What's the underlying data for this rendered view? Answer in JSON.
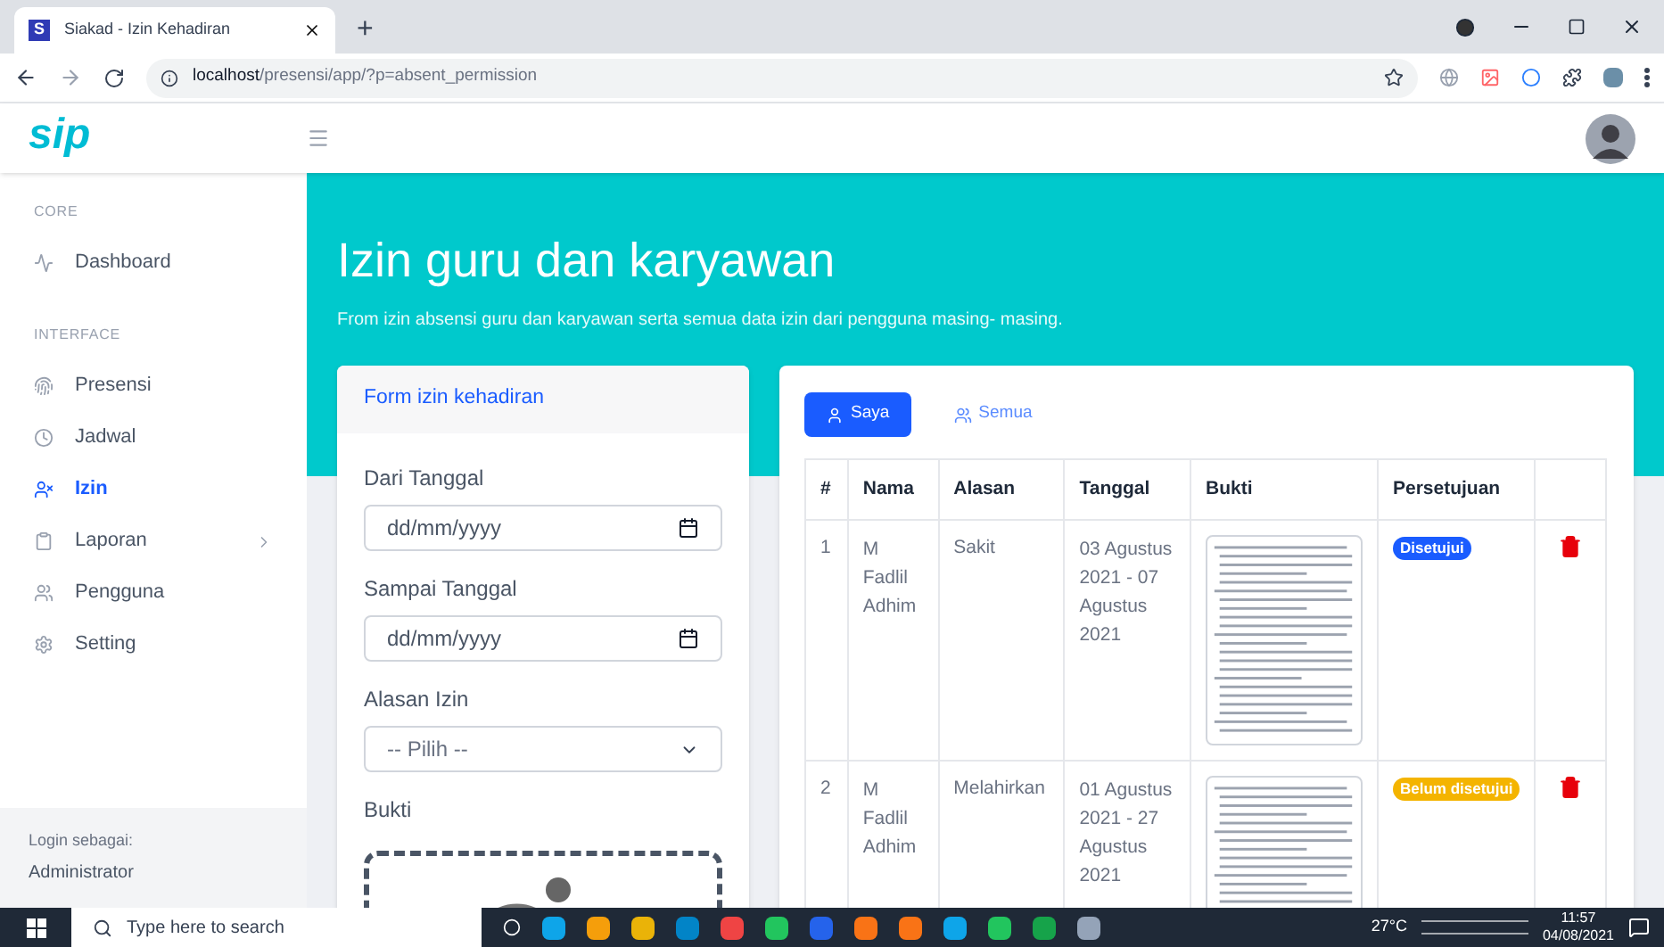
{
  "browser": {
    "tab_title": "Siakad - Izin Kehadiran",
    "tab_favicon": "S",
    "new_tab": "+",
    "url_host": "localhost",
    "url_path": "/presensi/app/?p=absent_permission"
  },
  "app": {
    "logo": "sip"
  },
  "sidebar": {
    "items": [
      {
        "kind": "heading",
        "label": "CORE"
      },
      {
        "kind": "link",
        "label": "Dashboard",
        "selected": false
      },
      {
        "kind": "heading",
        "label": "INTERFACE"
      },
      {
        "kind": "link",
        "label": "Presensi",
        "selected": false
      },
      {
        "kind": "link",
        "label": "Jadwal",
        "selected": false
      },
      {
        "kind": "link",
        "label": "Izin",
        "selected": true
      },
      {
        "kind": "link",
        "label": "Laporan",
        "selected": false,
        "expandable": true
      },
      {
        "kind": "link",
        "label": "Pengguna",
        "selected": false
      },
      {
        "kind": "link",
        "label": "Setting",
        "selected": false
      }
    ],
    "login_label": "Login sebagai:",
    "login_value": "Administrator"
  },
  "header": {
    "title": "Izin guru dan karyawan",
    "subtitle": "From izin absensi guru dan karyawan serta semua data izin dari pengguna masing- masing."
  },
  "form": {
    "title": "Form izin kehadiran",
    "fields": [
      {
        "kind": "date",
        "label": "Dari Tanggal",
        "placeholder": "dd/mm/yyyy"
      },
      {
        "kind": "date",
        "label": "Sampai Tanggal",
        "placeholder": "dd/mm/yyyy"
      },
      {
        "kind": "select",
        "label": "Alasan Izin",
        "value": "-- Pilih --"
      },
      {
        "kind": "upload",
        "label": "Bukti"
      }
    ]
  },
  "filters": [
    {
      "label": "Saya",
      "selected": true
    },
    {
      "label": "Semua",
      "selected": false
    }
  ],
  "table": {
    "columns": [
      "#",
      "Nama",
      "Alasan",
      "Tanggal",
      "Bukti",
      "Persetujuan"
    ],
    "rows": [
      {
        "no": "1",
        "nama": "M Fadlil Adhim",
        "alasan": "Sakit",
        "tanggal": "03 Agustus 2021 - 07 Agustus 2021",
        "status": {
          "kind": "approved",
          "text": "Disetujui"
        }
      },
      {
        "no": "2",
        "nama": "M Fadlil Adhim",
        "alasan": "Melahirkan",
        "tanggal": "01 Agustus 2021 - 27 Agustus 2021",
        "status": {
          "kind": "pending",
          "text": "Belum disetujui"
        }
      }
    ]
  },
  "taskbar": {
    "search_placeholder": "Type here to search",
    "weather": "27°C",
    "time": "11:57",
    "date": "04/08/2021"
  }
}
